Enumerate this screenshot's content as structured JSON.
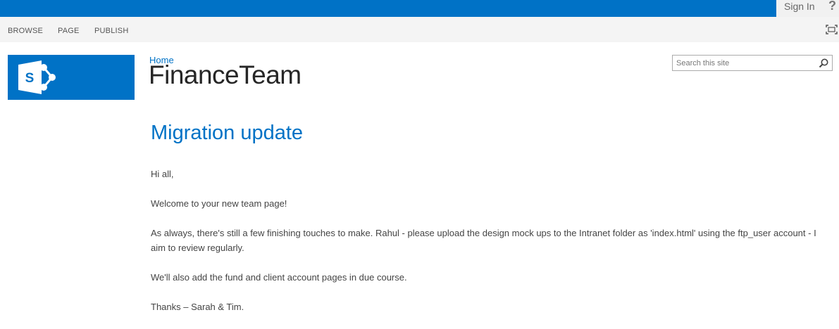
{
  "suitebar": {
    "sign_in_label": "Sign In",
    "help_label": "?",
    "color": "#0072c6"
  },
  "ribbon": {
    "tabs": [
      {
        "label": "BROWSE"
      },
      {
        "label": "PAGE"
      },
      {
        "label": "PUBLISH"
      }
    ],
    "focus_icon": "focus-on-content-icon"
  },
  "header": {
    "logo_icon": "sharepoint-logo-icon",
    "breadcrumb": "Home",
    "site_title": "FinanceTeam",
    "search_placeholder": "Search this site",
    "search_icon": "magnifier-icon"
  },
  "page": {
    "title": "Migration update",
    "paragraphs": [
      "Hi all,",
      "Welcome to your new team page!",
      "As always, there's still a few finishing touches to make.  Rahul - please upload the design mock ups to the Intranet folder as 'index.html' using the ftp_user account - I aim to review regularly.",
      "We'll also add the fund and client account pages in due course.",
      "Thanks – Sarah & Tim."
    ]
  }
}
